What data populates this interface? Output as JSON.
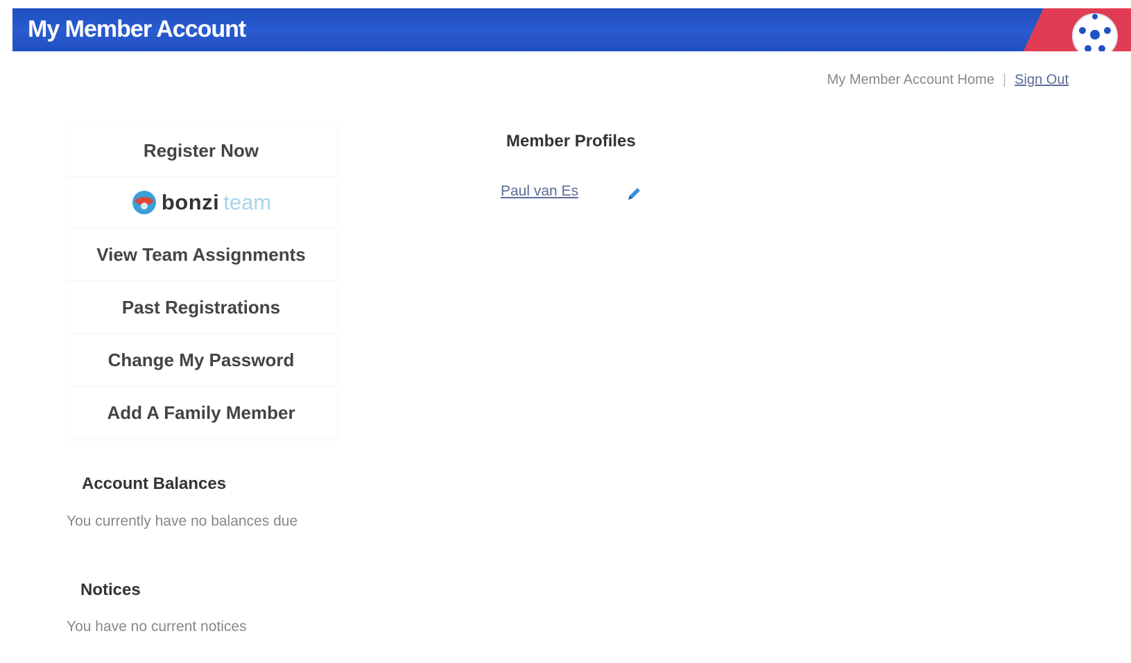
{
  "header": {
    "title": "My Member Account",
    "brand_color": "#2152c4",
    "accent_color": "#e23c54",
    "icon": "soccer-ball-icon"
  },
  "top_nav": {
    "home_label": "My Member Account Home",
    "separator": "|",
    "signout_label": "Sign Out"
  },
  "menu": {
    "items": [
      {
        "label": "Register Now"
      },
      {
        "logo_text": "bonzi",
        "logo_suffix": "team",
        "icon": "bonzi-logo-icon"
      },
      {
        "label": "View Team Assignments"
      },
      {
        "label": "Past Registrations"
      },
      {
        "label": "Change My Password"
      },
      {
        "label": "Add A Family Member"
      }
    ]
  },
  "account_balances": {
    "title": "Account Balances",
    "text": "You currently have no balances due"
  },
  "notices": {
    "title": "Notices",
    "text": "You have no current notices"
  },
  "member_profiles": {
    "title": "Member Profiles",
    "members": [
      {
        "name": "Paul van Es",
        "edit_icon": "pencil-icon"
      }
    ]
  }
}
